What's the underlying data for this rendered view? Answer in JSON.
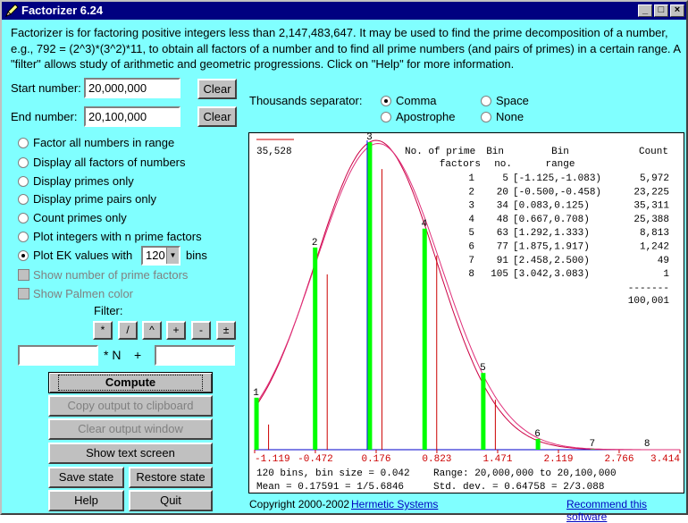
{
  "window": {
    "title": "Factorizer 6.24",
    "controls": {
      "minimize": "_",
      "maximize": "□",
      "close": "×"
    }
  },
  "intro": "Factorizer is for factoring positive integers less than 2,147,483,647.  It may be used to find the prime decomposition of a number, e.g., 792 = (2^3)*(3^2)*11, to obtain all factors of a number and to find all prime numbers (and pairs of primes) in a certain range.  A \"filter\" allows study of arithmetic and geometric progressions.  Click on \"Help\" for more information.",
  "start": {
    "label": "Start number:",
    "value": "20,000,000",
    "clear": "Clear"
  },
  "end": {
    "label": "End number:",
    "value": "20,100,000",
    "clear": "Clear"
  },
  "separator": {
    "label": "Thousands separator:",
    "options": [
      "Comma",
      "Space",
      "Apostrophe",
      "None"
    ],
    "selected": "Comma"
  },
  "modes": [
    "Factor all numbers in range",
    "Display all factors of numbers",
    "Display primes only",
    "Display prime pairs only",
    "Count primes only",
    "Plot integers with n  prime factors",
    "Plot EK values with"
  ],
  "selected_mode": "Plot EK values with",
  "bins": {
    "value": "120",
    "suffix": "bins"
  },
  "checks": [
    "Show number of prime factors",
    "Show Palmen color"
  ],
  "filter": {
    "label": "Filter:",
    "ops": [
      "*",
      "/",
      "^",
      "+",
      "-",
      "±"
    ],
    "times_n": "* N",
    "plus": "+",
    "left_value": "",
    "right_value": ""
  },
  "buttons": {
    "compute": "Compute",
    "copy": "Copy output to clipboard",
    "clear_output": "Clear output window",
    "show_text": "Show text screen",
    "save": "Save state",
    "restore": "Restore state",
    "help": "Help",
    "quit": "Quit"
  },
  "footer": {
    "copyright": "Copyright 2000-2002",
    "company": "Hermetic Systems",
    "recommend": "Recommend this software"
  },
  "colors": {
    "background": "#80ffff",
    "title_bar": "#000080",
    "bars": "#00ff00",
    "curves": "#cc0044",
    "mean_line": "#0000ff",
    "axis_labels": "#cc0000"
  },
  "chart_data": {
    "type": "bar",
    "peak_label": "35,528",
    "table_headers": [
      "No. of prime",
      "Bin",
      "Bin",
      "Count"
    ],
    "table_headers2": [
      "factors",
      "no.",
      "range",
      ""
    ],
    "rows": [
      {
        "factors": "1",
        "bin": "5",
        "range": "[-1.125,-1.083)",
        "count": "5,972"
      },
      {
        "factors": "2",
        "bin": "20",
        "range": "[-0.500,-0.458)",
        "count": "23,225"
      },
      {
        "factors": "3",
        "bin": "34",
        "range": "[0.083,0.125)",
        "count": "35,311"
      },
      {
        "factors": "4",
        "bin": "48",
        "range": "[0.667,0.708)",
        "count": "25,388"
      },
      {
        "factors": "5",
        "bin": "63",
        "range": "[1.292,1.333)",
        "count": "8,813"
      },
      {
        "factors": "6",
        "bin": "77",
        "range": "[1.875,1.917)",
        "count": "1,242"
      },
      {
        "factors": "7",
        "bin": "91",
        "range": "[2.458,2.500)",
        "count": "49"
      },
      {
        "factors": "8",
        "bin": "105",
        "range": "[3.042,3.083)",
        "count": "1"
      }
    ],
    "total_rule": "-------",
    "total": "100,001",
    "bars": [
      {
        "label": "1",
        "value": 5972
      },
      {
        "label": "2",
        "value": 23225
      },
      {
        "label": "3",
        "value": 35311
      },
      {
        "label": "4",
        "value": 25388
      },
      {
        "label": "5",
        "value": 8813
      },
      {
        "label": "6",
        "value": 1242
      },
      {
        "label": "7",
        "value": 49
      },
      {
        "label": "8",
        "value": 1
      }
    ],
    "xticks": [
      "-1.119",
      "-0.472",
      "0.176",
      "0.823",
      "1.471",
      "2.119",
      "2.766",
      "3.414"
    ],
    "stats1": "120 bins, bin size = 0.042",
    "stats1b": "Range: 20,000,000 to 20,100,000",
    "stats2": "Mean = 0.17591 = 1/5.6846",
    "stats2b": "Std. dev. = 0.64758 = 2/3.088"
  }
}
